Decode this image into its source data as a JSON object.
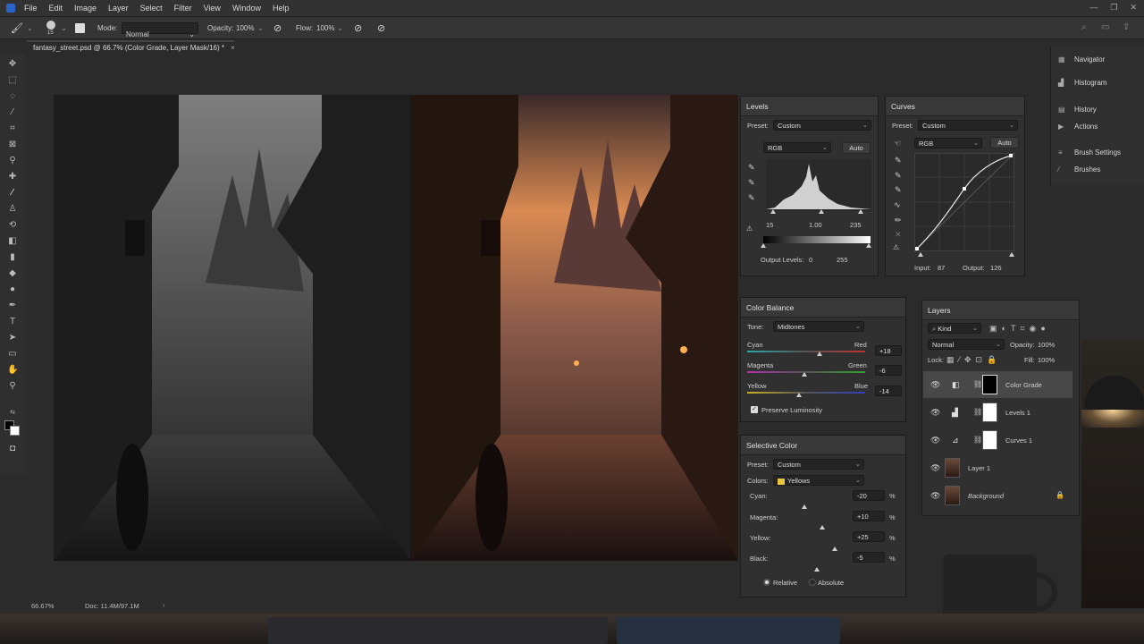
{
  "menu": [
    "File",
    "Edit",
    "Image",
    "Layer",
    "Select",
    "Filter",
    "View",
    "Window",
    "Help"
  ],
  "options": {
    "brush_size": "15",
    "mode_label": "Mode:",
    "mode_value": "Normal",
    "opacity_label": "Opacity:",
    "opacity_value": "100%",
    "flow_label": "Flow:",
    "flow_value": "100%"
  },
  "document_tab": "fantasy_street.psd @ 66.7% (Color Grade, Layer Mask/16) *",
  "levels": {
    "title": "Levels",
    "preset_label": "Preset:",
    "preset_value": "Custom",
    "channel": "RGB",
    "auto": "Auto",
    "input_black": "15",
    "input_gamma": "1.00",
    "input_white": "235",
    "output_label": "Output Levels:",
    "output_black": "0",
    "output_white": "255"
  },
  "curves": {
    "title": "Curves",
    "preset_label": "Preset:",
    "preset_value": "Custom",
    "channel": "RGB",
    "auto": "Auto",
    "input_label": "Input:",
    "input_value": "87",
    "output_label": "Output:",
    "output_value": "126"
  },
  "color_balance": {
    "title": "Color Balance",
    "tone_label": "Tone:",
    "tone_value": "Midtones",
    "sliders": [
      {
        "left": "Cyan",
        "right": "Red",
        "value": "+18",
        "pos": 0.59
      },
      {
        "left": "Magenta",
        "right": "Green",
        "value": "-6",
        "pos": 0.47
      },
      {
        "left": "Yellow",
        "right": "Blue",
        "value": "-14",
        "pos": 0.43
      }
    ],
    "preserve": "Preserve Luminosity"
  },
  "selective_color": {
    "title": "Selective Color",
    "preset_label": "Preset:",
    "preset_value": "Custom",
    "colors_label": "Colors:",
    "colors_value": "Yellows",
    "rows": [
      {
        "label": "Cyan:",
        "value": "-20",
        "pos": 0.4
      },
      {
        "label": "Magenta:",
        "value": "+10",
        "pos": 0.55
      },
      {
        "label": "Yellow:",
        "value": "+25",
        "pos": 0.62
      },
      {
        "label": "Black:",
        "value": "-5",
        "pos": 0.47
      }
    ],
    "relative": "Relative",
    "absolute": "Absolute"
  },
  "layers": {
    "title": "Layers",
    "kind": "Kind",
    "blend": "Normal",
    "opacity_label": "Opacity:",
    "opacity_value": "100%",
    "lock_label": "Lock:",
    "fill_label": "Fill:",
    "fill_value": "100%",
    "items": [
      {
        "name": "Color Grade"
      },
      {
        "name": "Levels 1"
      },
      {
        "name": "Curves 1"
      },
      {
        "name": "Layer 1"
      },
      {
        "name": "Background"
      }
    ]
  },
  "sidebar": [
    {
      "label": "Navigator",
      "icon": "navigator-icon"
    },
    {
      "label": "Histogram",
      "icon": "histogram-icon"
    },
    {
      "label": "History",
      "icon": "history-icon"
    },
    {
      "label": "Actions",
      "icon": "actions-icon"
    },
    {
      "label": "Brush Settings",
      "icon": "brush-settings-icon"
    },
    {
      "label": "Brushes",
      "icon": "brushes-icon"
    }
  ],
  "status": {
    "zoom": "66.67%",
    "doc": "Doc: 11.4M/97.1M"
  }
}
